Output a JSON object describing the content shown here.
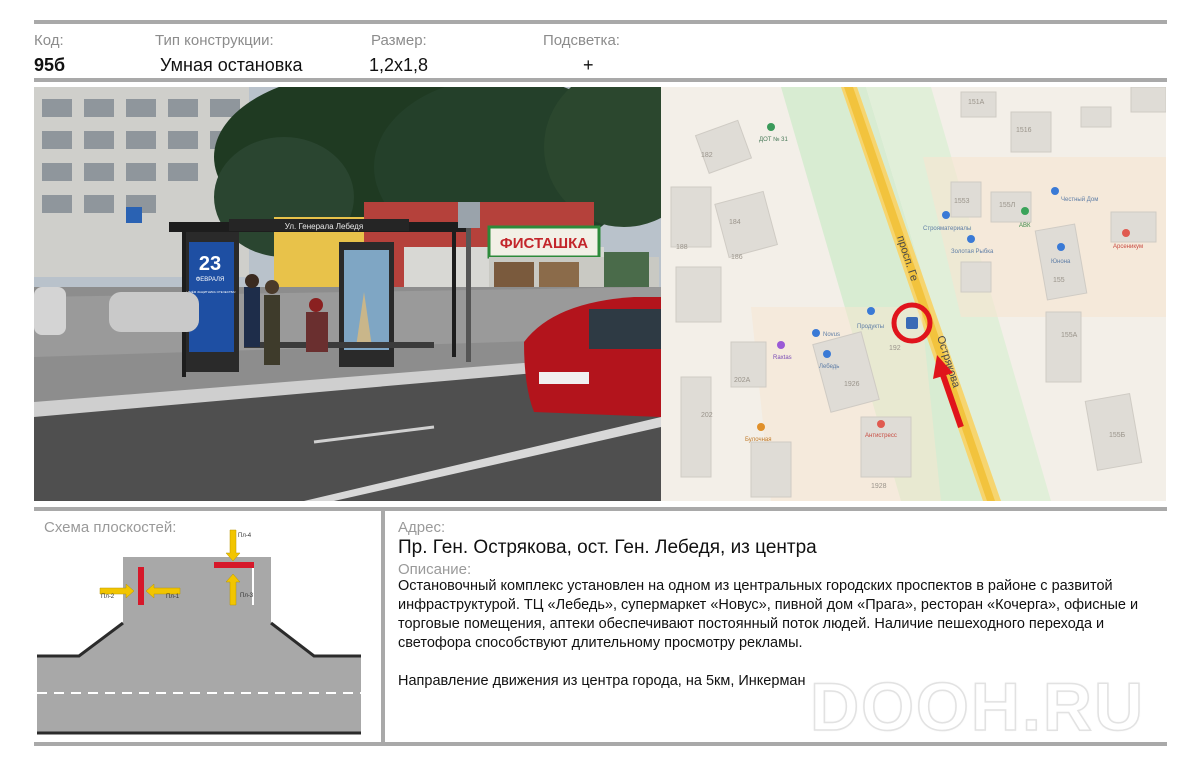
{
  "header": {
    "code_label": "Код:",
    "code_value": "95б",
    "type_label": "Тип конструкции:",
    "type_value": "Умная остановка",
    "size_label": "Размер:",
    "size_value": "1,2х1,8",
    "light_label": "Подсветка:",
    "light_value": "+"
  },
  "photo": {
    "shelter_sign": "Ул. Генерала Лебедя",
    "kiosk_sign": "ФИСТАШКА",
    "poster_number": "23",
    "poster_month": "ФЕВРАЛЯ",
    "poster_text": "С ДНЁМ ЗАЩИТНИКА ОТЕЧЕСТВА!"
  },
  "map": {
    "street_label": "просп. Генерала Острякова",
    "street_part1": "просп. Ге",
    "street_part2": "Острякова",
    "poi": {
      "dot": "ДОТ № 31",
      "stroy": "Строяматериалы",
      "zolotaya": "Золотая Рыбка",
      "abk": "АВК",
      "chestny": "Честный Дом",
      "yunona": "Юнона",
      "arsenikum": "Арсеникум",
      "produkty": "Продукты",
      "novus": "Novus",
      "raxtas": "Raxtas",
      "lebed": "Лебедь",
      "bulochnaya": "Булочная",
      "antistress": "Антистресс"
    },
    "buildings": {
      "b151a": "151А",
      "b1516": "1516",
      "b182": "182",
      "b1553": "1553",
      "b155l": "155Л",
      "b184": "184",
      "b186": "186",
      "b188": "188",
      "b155": "155",
      "b155a": "155А",
      "b192": "192",
      "b202a": "202А",
      "b1926": "1926",
      "b202": "202",
      "b155b": "155Б",
      "b1928": "1928"
    },
    "accent_color": "#e0141c"
  },
  "scheme": {
    "title": "Схема плоскостей:",
    "p1": "Пл-1",
    "p2": "Пл-2",
    "p3": "Пл-3",
    "p4": "Пл-4"
  },
  "info": {
    "address_label": "Адрес:",
    "address": "Пр. Ген. Острякова,  ост. Ген. Лебедя, из центра",
    "description_label": "Описание:",
    "description": "Остановочный комплекс установлен на одном из центральных городских проспектов в районе с развитой инфраструктурой. ТЦ «Лебедь», супермаркет «Новус», пивной дом «Прага», ресторан «Кочерга», офисные и торговые помещения, аптеки обеспечивают постоянный поток людей. Наличие пешеходного перехода и светофора способствуют длительному просмотру рекламы.",
    "direction": "Направление движения из центра города, на 5км, Инкерман"
  },
  "watermark": "DOOH.RU"
}
